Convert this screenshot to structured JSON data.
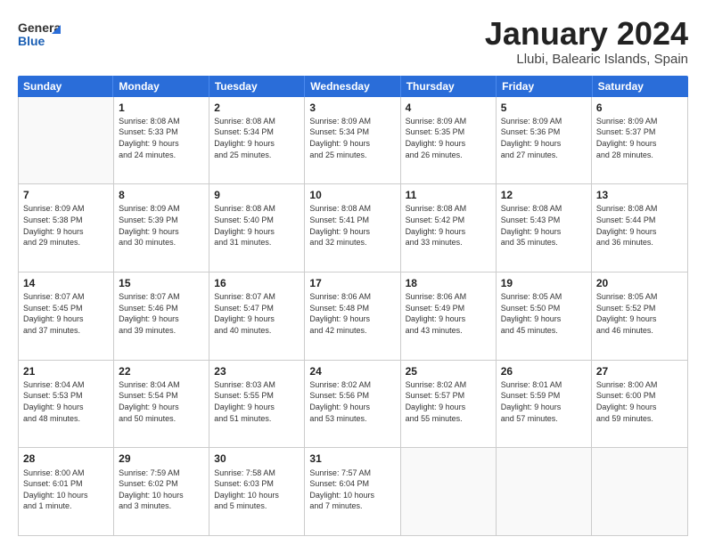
{
  "header": {
    "logo_text_general": "General",
    "logo_text_blue": "Blue",
    "title": "January 2024",
    "subtitle": "Llubi, Balearic Islands, Spain"
  },
  "calendar": {
    "days_of_week": [
      "Sunday",
      "Monday",
      "Tuesday",
      "Wednesday",
      "Thursday",
      "Friday",
      "Saturday"
    ],
    "weeks": [
      [
        {
          "day": "",
          "info": ""
        },
        {
          "day": "1",
          "info": "Sunrise: 8:08 AM\nSunset: 5:33 PM\nDaylight: 9 hours\nand 24 minutes."
        },
        {
          "day": "2",
          "info": "Sunrise: 8:08 AM\nSunset: 5:34 PM\nDaylight: 9 hours\nand 25 minutes."
        },
        {
          "day": "3",
          "info": "Sunrise: 8:09 AM\nSunset: 5:34 PM\nDaylight: 9 hours\nand 25 minutes."
        },
        {
          "day": "4",
          "info": "Sunrise: 8:09 AM\nSunset: 5:35 PM\nDaylight: 9 hours\nand 26 minutes."
        },
        {
          "day": "5",
          "info": "Sunrise: 8:09 AM\nSunset: 5:36 PM\nDaylight: 9 hours\nand 27 minutes."
        },
        {
          "day": "6",
          "info": "Sunrise: 8:09 AM\nSunset: 5:37 PM\nDaylight: 9 hours\nand 28 minutes."
        }
      ],
      [
        {
          "day": "7",
          "info": "Sunrise: 8:09 AM\nSunset: 5:38 PM\nDaylight: 9 hours\nand 29 minutes."
        },
        {
          "day": "8",
          "info": "Sunrise: 8:09 AM\nSunset: 5:39 PM\nDaylight: 9 hours\nand 30 minutes."
        },
        {
          "day": "9",
          "info": "Sunrise: 8:08 AM\nSunset: 5:40 PM\nDaylight: 9 hours\nand 31 minutes."
        },
        {
          "day": "10",
          "info": "Sunrise: 8:08 AM\nSunset: 5:41 PM\nDaylight: 9 hours\nand 32 minutes."
        },
        {
          "day": "11",
          "info": "Sunrise: 8:08 AM\nSunset: 5:42 PM\nDaylight: 9 hours\nand 33 minutes."
        },
        {
          "day": "12",
          "info": "Sunrise: 8:08 AM\nSunset: 5:43 PM\nDaylight: 9 hours\nand 35 minutes."
        },
        {
          "day": "13",
          "info": "Sunrise: 8:08 AM\nSunset: 5:44 PM\nDaylight: 9 hours\nand 36 minutes."
        }
      ],
      [
        {
          "day": "14",
          "info": "Sunrise: 8:07 AM\nSunset: 5:45 PM\nDaylight: 9 hours\nand 37 minutes."
        },
        {
          "day": "15",
          "info": "Sunrise: 8:07 AM\nSunset: 5:46 PM\nDaylight: 9 hours\nand 39 minutes."
        },
        {
          "day": "16",
          "info": "Sunrise: 8:07 AM\nSunset: 5:47 PM\nDaylight: 9 hours\nand 40 minutes."
        },
        {
          "day": "17",
          "info": "Sunrise: 8:06 AM\nSunset: 5:48 PM\nDaylight: 9 hours\nand 42 minutes."
        },
        {
          "day": "18",
          "info": "Sunrise: 8:06 AM\nSunset: 5:49 PM\nDaylight: 9 hours\nand 43 minutes."
        },
        {
          "day": "19",
          "info": "Sunrise: 8:05 AM\nSunset: 5:50 PM\nDaylight: 9 hours\nand 45 minutes."
        },
        {
          "day": "20",
          "info": "Sunrise: 8:05 AM\nSunset: 5:52 PM\nDaylight: 9 hours\nand 46 minutes."
        }
      ],
      [
        {
          "day": "21",
          "info": "Sunrise: 8:04 AM\nSunset: 5:53 PM\nDaylight: 9 hours\nand 48 minutes."
        },
        {
          "day": "22",
          "info": "Sunrise: 8:04 AM\nSunset: 5:54 PM\nDaylight: 9 hours\nand 50 minutes."
        },
        {
          "day": "23",
          "info": "Sunrise: 8:03 AM\nSunset: 5:55 PM\nDaylight: 9 hours\nand 51 minutes."
        },
        {
          "day": "24",
          "info": "Sunrise: 8:02 AM\nSunset: 5:56 PM\nDaylight: 9 hours\nand 53 minutes."
        },
        {
          "day": "25",
          "info": "Sunrise: 8:02 AM\nSunset: 5:57 PM\nDaylight: 9 hours\nand 55 minutes."
        },
        {
          "day": "26",
          "info": "Sunrise: 8:01 AM\nSunset: 5:59 PM\nDaylight: 9 hours\nand 57 minutes."
        },
        {
          "day": "27",
          "info": "Sunrise: 8:00 AM\nSunset: 6:00 PM\nDaylight: 9 hours\nand 59 minutes."
        }
      ],
      [
        {
          "day": "28",
          "info": "Sunrise: 8:00 AM\nSunset: 6:01 PM\nDaylight: 10 hours\nand 1 minute."
        },
        {
          "day": "29",
          "info": "Sunrise: 7:59 AM\nSunset: 6:02 PM\nDaylight: 10 hours\nand 3 minutes."
        },
        {
          "day": "30",
          "info": "Sunrise: 7:58 AM\nSunset: 6:03 PM\nDaylight: 10 hours\nand 5 minutes."
        },
        {
          "day": "31",
          "info": "Sunrise: 7:57 AM\nSunset: 6:04 PM\nDaylight: 10 hours\nand 7 minutes."
        },
        {
          "day": "",
          "info": ""
        },
        {
          "day": "",
          "info": ""
        },
        {
          "day": "",
          "info": ""
        }
      ]
    ]
  }
}
